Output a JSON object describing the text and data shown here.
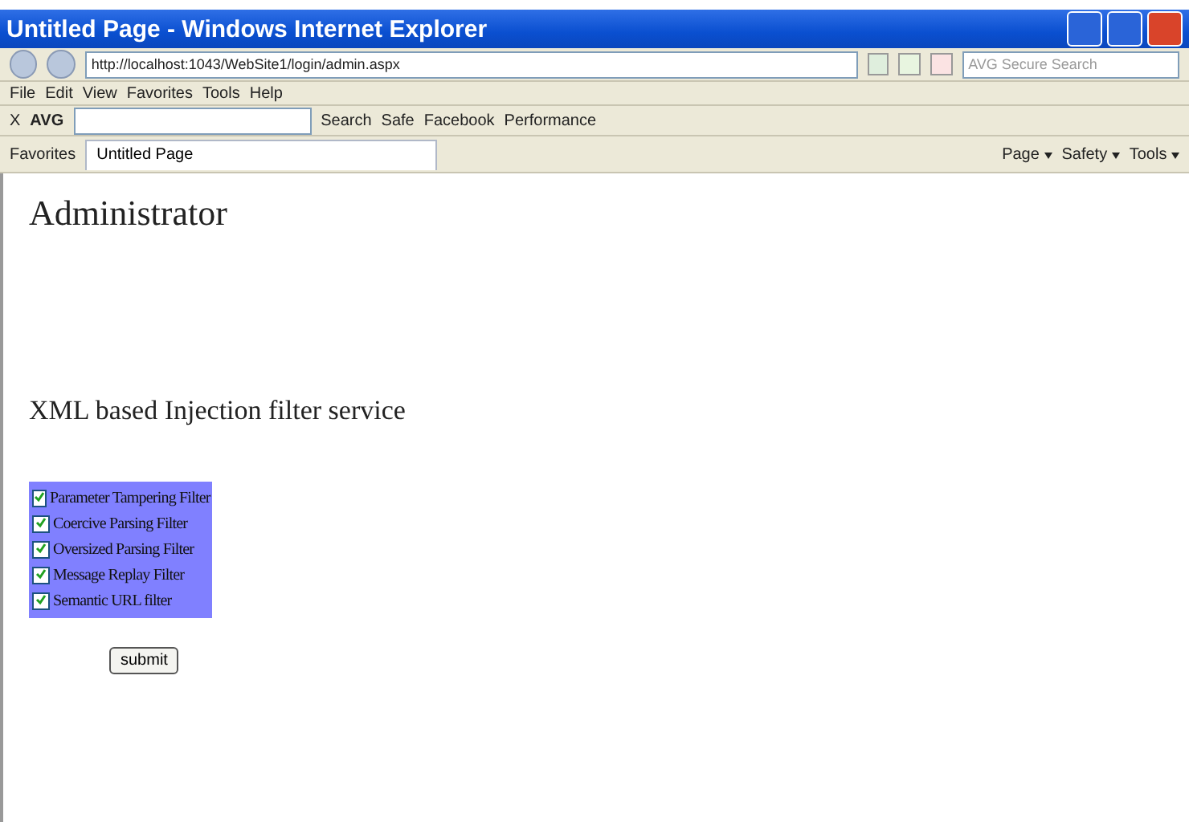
{
  "window": {
    "title": "Untitled Page - Windows Internet Explorer"
  },
  "address": {
    "url": "http://localhost:1043/WebSite1/login/admin.aspx",
    "search_placeholder": "AVG Secure Search"
  },
  "menu": [
    "File",
    "Edit",
    "View",
    "Favorites",
    "Tools",
    "Help"
  ],
  "toolbar": {
    "close": "X",
    "brand": "AVG",
    "search": "Search",
    "safe": "Safe",
    "facebook": "Facebook",
    "performance": "Performance"
  },
  "favorites": {
    "label": "Favorites",
    "tab": "Untitled Page",
    "commands": [
      "Page",
      "Safety",
      "Tools"
    ]
  },
  "page": {
    "heading": "Administrator",
    "subheading": "XML based Injection filter service",
    "filters": [
      {
        "label": "Parameter Tampering Filter",
        "checked": true
      },
      {
        "label": "Coercive Parsing Filter",
        "checked": true
      },
      {
        "label": "Oversized Parsing Filter",
        "checked": true
      },
      {
        "label": "Message Replay Filter",
        "checked": true
      },
      {
        "label": "Semantic URL filter",
        "checked": true
      }
    ],
    "button": "submit"
  }
}
